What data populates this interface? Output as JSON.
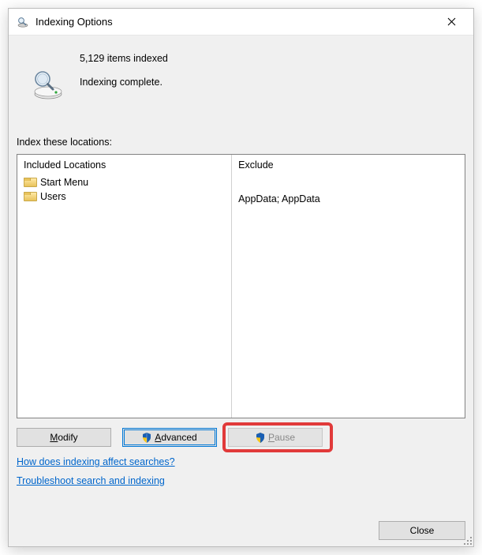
{
  "title": "Indexing Options",
  "status": {
    "count_line": "5,129 items indexed",
    "state_line": "Indexing complete."
  },
  "locations": {
    "section_label": "Index these locations:",
    "included_header": "Included Locations",
    "exclude_header": "Exclude",
    "rows": [
      {
        "name": "Start Menu",
        "exclude": ""
      },
      {
        "name": "Users",
        "exclude": "AppData; AppData"
      }
    ]
  },
  "buttons": {
    "modify": "Modify",
    "advanced": "Advanced",
    "pause": "Pause",
    "close": "Close"
  },
  "links": {
    "how": "How does indexing affect searches?",
    "troubleshoot": "Troubleshoot search and indexing"
  }
}
